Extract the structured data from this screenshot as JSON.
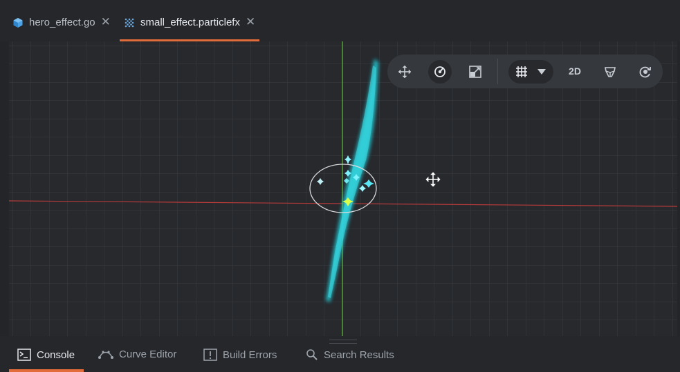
{
  "tabs": [
    {
      "label": "hero_effect.go",
      "icon": "cube-icon",
      "active": false
    },
    {
      "label": "small_effect.particlefx",
      "icon": "particles-icon",
      "active": true
    }
  ],
  "toolbar": {
    "tools": [
      "move-tool-icon",
      "rotate-tool-icon",
      "scale-tool-icon"
    ],
    "grid_icon": "grid-icon",
    "mode_label": "2D",
    "visibility_icon": "visibility-filter-icon",
    "camera_icon": "camera-reset-icon"
  },
  "bottom_tabs": [
    {
      "label": "Console",
      "icon": "console-icon",
      "active": true
    },
    {
      "label": "Curve Editor",
      "icon": "curve-icon",
      "active": false
    },
    {
      "label": "Build Errors",
      "icon": "error-icon",
      "active": false
    },
    {
      "label": "Search Results",
      "icon": "search-icon",
      "active": false
    }
  ],
  "colors": {
    "accent": "#e36d3a",
    "particle": "#2fd4dc",
    "x_axis": "#b83a3a",
    "y_axis": "#5fbf3a"
  }
}
